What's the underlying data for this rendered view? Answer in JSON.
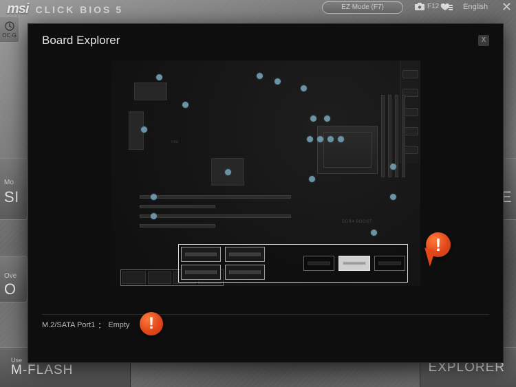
{
  "header": {
    "brand_msi": "msi",
    "brand_click": "CLICK BIOS",
    "brand_five": "5",
    "ez_mode": "EZ Mode (F7)",
    "screenshot_key": "F12",
    "language": "English",
    "close": "✕"
  },
  "left_tab": {
    "oc": "OC G"
  },
  "side_peeks": {
    "label1": "Mo",
    "title1": "SI",
    "label2": "Ove",
    "title2": "O",
    "title3": "E"
  },
  "bottom": {
    "left_small": "Use",
    "left_big": "M-FLASH",
    "right_big": "EXPLORER"
  },
  "modal": {
    "title": "Board Explorer",
    "close": "X",
    "status_port": "M.2/SATA Port1",
    "status_sep": "：",
    "status_value": "Empty",
    "board_label_ddr": "DDR4 BOOST",
    "board_label_msi": "msi",
    "alert_glyph": "!"
  }
}
